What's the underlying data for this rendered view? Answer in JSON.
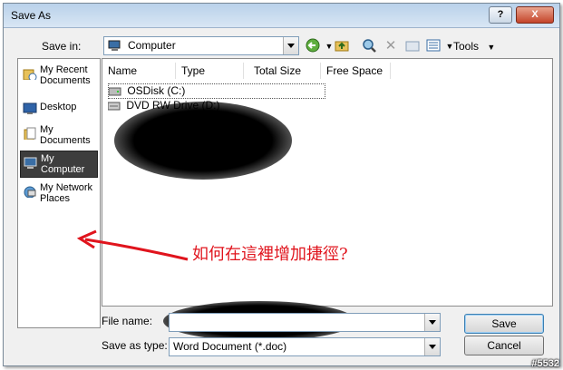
{
  "window": {
    "title": "Save As",
    "help": "?",
    "close": "X"
  },
  "save_in": {
    "label": "Save in:",
    "value": "Computer"
  },
  "toolbar": {
    "back_icon": "back-arrow-icon",
    "up_icon": "folder-up-icon",
    "search_icon": "search-web-icon",
    "delete_icon": "delete-x-icon",
    "new_folder_icon": "new-folder-icon",
    "views_icon": "views-icon",
    "tools_label": "Tools"
  },
  "places": [
    {
      "label": "My Recent Documents",
      "icon": "recent-documents-icon"
    },
    {
      "label": "Desktop",
      "icon": "desktop-icon"
    },
    {
      "label": "My Documents",
      "icon": "my-documents-icon"
    },
    {
      "label": "My Computer",
      "icon": "my-computer-icon",
      "selected": true
    },
    {
      "label": "My Network Places",
      "icon": "network-places-icon"
    }
  ],
  "columns": [
    "Name",
    "Type",
    "Total Size",
    "Free Space"
  ],
  "files": [
    {
      "name": "OSDisk (C:)",
      "icon": "hard-disk-icon"
    },
    {
      "name": "DVD RW Drive (D:)",
      "icon": "dvd-drive-icon"
    }
  ],
  "file_name": {
    "label": "File name:",
    "value": ""
  },
  "save_as_type": {
    "label": "Save as type:",
    "value": "Word Document (*.doc)"
  },
  "buttons": {
    "save": "Save",
    "cancel": "Cancel"
  },
  "annotation": "如何在這裡增加捷徑?",
  "watermark": "#5532",
  "colors": {
    "annotation": "#e0141d",
    "titlebar": "#b9d1ea",
    "selected_place": "#3d3d3d"
  }
}
